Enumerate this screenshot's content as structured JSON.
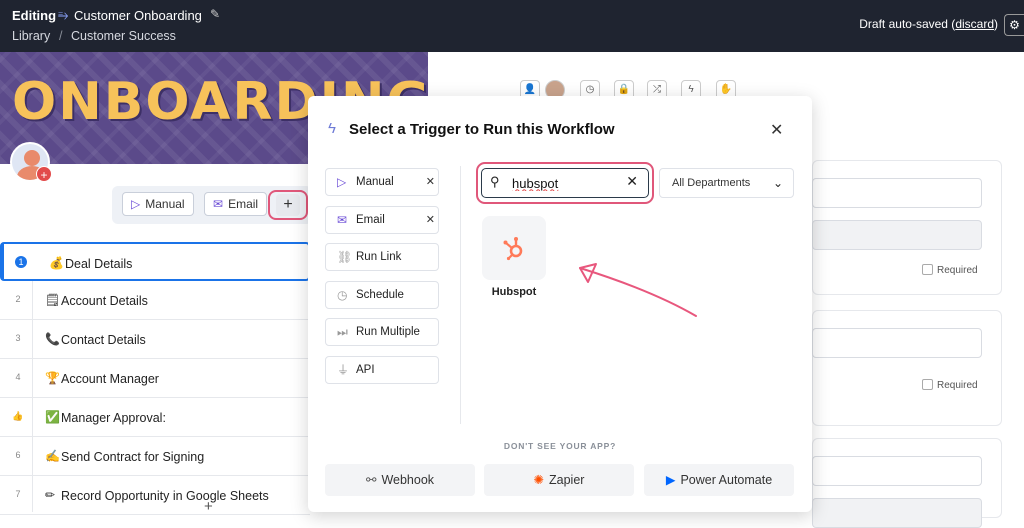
{
  "header": {
    "editing_label": "Editing",
    "workflow_title": "Customer Onboarding",
    "breadcrumb": [
      "Library",
      "/",
      "Customer Success"
    ],
    "draft_status_prefix": "Draft auto-saved (",
    "draft_discard": "discard",
    "draft_status_suffix": ")"
  },
  "banner": {
    "text": "ONBOARDING"
  },
  "trigger_bar": {
    "manual_label": "Manual",
    "email_label": "Email",
    "add_label": "+"
  },
  "steps": [
    {
      "num": "1",
      "emoji": "💰",
      "label": "Deal Details"
    },
    {
      "num": "2",
      "emoji": "🗒",
      "label": "Account Details"
    },
    {
      "num": "3",
      "emoji": "📞",
      "label": "Contact Details"
    },
    {
      "num": "4",
      "emoji": "🏆",
      "label": "Account Manager"
    },
    {
      "num": "👍",
      "emoji": "✅",
      "label": "Manager Approval:"
    },
    {
      "num": "6",
      "emoji": "✍",
      "label": "Send Contract for Signing"
    },
    {
      "num": "7",
      "emoji": "✏",
      "label": "Record Opportunity in Google Sheets"
    }
  ],
  "right_panel": {
    "required_label": "Required"
  },
  "modal": {
    "title": "Select a Trigger to Run this Workflow",
    "trigger_types": [
      {
        "label": "Manual",
        "icon": "play-icon",
        "removable": true
      },
      {
        "label": "Email",
        "icon": "mail-icon",
        "removable": true
      },
      {
        "label": "Run Link",
        "icon": "link-icon",
        "removable": false
      },
      {
        "label": "Schedule",
        "icon": "clock-icon",
        "removable": false
      },
      {
        "label": "Run Multiple",
        "icon": "fast-forward-icon",
        "removable": false
      },
      {
        "label": "API",
        "icon": "plug-icon",
        "removable": false
      }
    ],
    "search": {
      "value": "hubspot"
    },
    "department_select": "All Departments",
    "results": [
      {
        "name": "Hubspot",
        "icon": "hubspot-icon",
        "color": "#ff7a59"
      }
    ],
    "dont_see_label": "DON'T SEE YOUR APP?",
    "alternatives": [
      {
        "label": "Webhook",
        "icon": "webhook-icon"
      },
      {
        "label": "Zapier",
        "icon": "zapier-icon",
        "color": "#ff4f00"
      },
      {
        "label": "Power Automate",
        "icon": "power-automate-icon",
        "color": "#0066ff"
      }
    ]
  }
}
